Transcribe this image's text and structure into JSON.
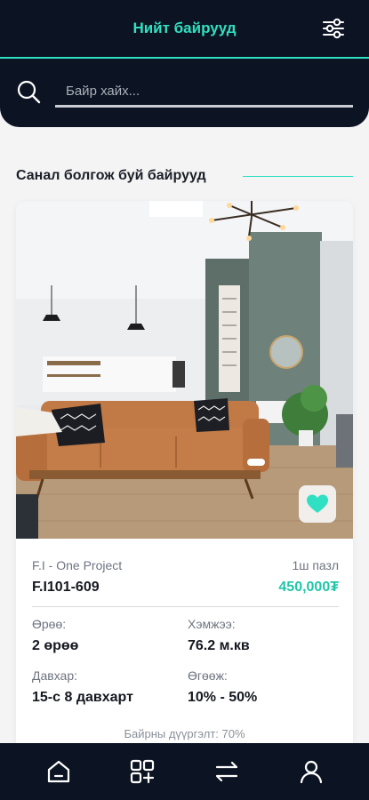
{
  "header": {
    "title": "Нийт байрууд",
    "filter_icon": "sliders-icon",
    "accent_color": "#2fe0c2",
    "bg_color": "#0c1322"
  },
  "search": {
    "placeholder": "Байр хайх...",
    "value": ""
  },
  "section": {
    "title": "Санал болгож буй байрууд"
  },
  "listing": {
    "project_name": "F.I - One Project",
    "unit_code": "F.I101-609",
    "price_unit": "1ш пазл",
    "price": "450,000₮",
    "rooms_label": "Өрөө:",
    "rooms_value": "2 өрөө",
    "size_label": "Хэмжээ:",
    "size_value": "76.2 м.кв",
    "floor_label": "Давхар:",
    "floor_value": "15-с 8 давхарт",
    "discount_label": "Өгөөж:",
    "discount_value": "10% - 50%",
    "fill_note": "Байрны дүүргэлт: 70%"
  },
  "bottom_nav": {
    "items": [
      "home-icon",
      "add-grid-icon",
      "swap-icon",
      "profile-icon"
    ]
  }
}
